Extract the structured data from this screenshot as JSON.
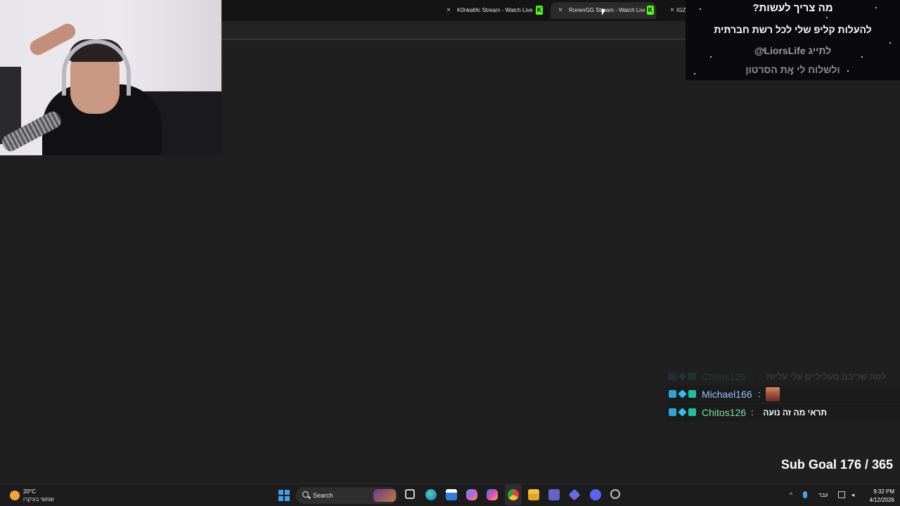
{
  "browser": {
    "new_tab_label": "+",
    "tabs": [
      {
        "title": "K0nkaMc Stream - Watch Live ",
        "close": "×",
        "active": false
      },
      {
        "title": "RonenGG Stream - Watch Live ",
        "close": "×",
        "active": true
      },
      {
        "title": "IGZ",
        "close": "×",
        "active": false
      }
    ]
  },
  "info_box": {
    "line1": "מה צריך לעשות?",
    "line2": "להעלות קליפ שלי לכל רשת חברתית",
    "line3": "לתייג LiorsLife@",
    "line4": "ולשלוח לי את הסרטון"
  },
  "chat": {
    "messages": [
      {
        "user": "Chitos126",
        "color": "#8ff0a8",
        "separator": ":",
        "text": "למה שריבם מעליליים עלי עליות",
        "faded": true,
        "emote": false
      },
      {
        "user": "Michael166",
        "color": "#8fc3ff",
        "separator": ":",
        "text": "",
        "faded": false,
        "emote": true
      },
      {
        "user": "Chitos126",
        "color": "#7fe3a8",
        "separator": ":",
        "text": "תראי מה זה נועה",
        "faded": false,
        "emote": false
      }
    ]
  },
  "sub_goal": "Sub Goal 176 / 365",
  "taskbar": {
    "weather_temp": "20°C",
    "weather_desc": "שמשי בעיקרו",
    "search_label": "Search",
    "language": "עבר",
    "time": "9:32 PM",
    "date": "4/12/2026",
    "icons": [
      "start-icon",
      "search-icon",
      "task-view-icon",
      "edge-icon",
      "store-icon",
      "copilot-icon",
      "m365-icon",
      "chrome-icon",
      "file-explorer-icon",
      "teams-icon",
      "vpn-icon",
      "discord-icon",
      "app-icon"
    ],
    "accent": "#3c9ff0"
  }
}
